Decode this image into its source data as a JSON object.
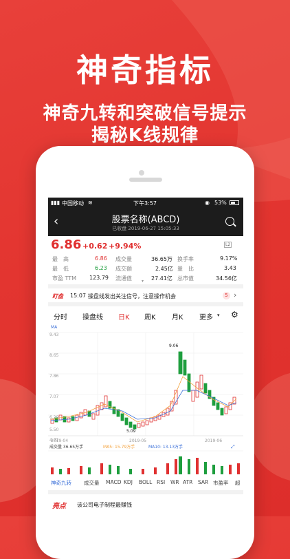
{
  "headline": {
    "title": "神奇指标",
    "line1": "神奇九转和突破信号提示",
    "line2": "揭秘K线规律"
  },
  "status": {
    "carrier": "中国移动",
    "time": "下午3:57",
    "battery": "53%"
  },
  "nav": {
    "title": "股票名称(ABCD)",
    "subtitle": "已收盘 2019-06-27 15:05:33"
  },
  "quote": {
    "price": "6.86",
    "change": "+0.62",
    "change_pct": "+9.94%",
    "level_badge": "L2",
    "rows": [
      {
        "l1": "最　高",
        "v1": "6.86",
        "l2": "成交量",
        "v2": "36.65万",
        "l3": "换手率",
        "v3": "9.17%"
      },
      {
        "l1": "最　低",
        "v1": "6.23",
        "l2": "成交额",
        "v2": "2.45亿",
        "l3": "量　比",
        "v3": "3.43"
      },
      {
        "l1": "市盈 TTM",
        "v1": "123.79",
        "l2": "流通值",
        "v2": "27.41亿",
        "l3": "总市值",
        "v3": "34.56亿"
      }
    ]
  },
  "alert": {
    "tag": "盯盘",
    "time": "15:07",
    "text": "操盘线发出关注信号，注意操作机会",
    "count": "5"
  },
  "tabs": [
    {
      "label": "分时"
    },
    {
      "label": "操盘线"
    },
    {
      "label": "日K"
    },
    {
      "label": "周K"
    },
    {
      "label": "月K"
    },
    {
      "label": "更多"
    }
  ],
  "chart": {
    "ma_label": "MA",
    "y_labels": [
      "9.43",
      "8.65",
      "7.86",
      "7.07",
      "6.29",
      "5.50",
      "4.72"
    ],
    "x_labels": [
      "2019-04",
      "2019-05",
      "2019-06"
    ],
    "hi_label": "9.06",
    "lo_label": "5.09",
    "volume_legend": {
      "vol": "成交量 36.65万手",
      "ma5": "MA5: 15.79万手",
      "ma10": "MA10: 13.13万手"
    }
  },
  "bottom_tabs": [
    "神奇九转",
    "成交量",
    "MACD",
    "KDJ",
    "BOLL",
    "RSI",
    "WR",
    "ATR",
    "SAR",
    "市盈率",
    "超"
  ],
  "highlight": {
    "tag": "亮点",
    "text": "该公司电子制程最赚钱"
  },
  "colors": {
    "up": "#e03030",
    "down": "#1e9e3e",
    "brand": "#e33530"
  }
}
